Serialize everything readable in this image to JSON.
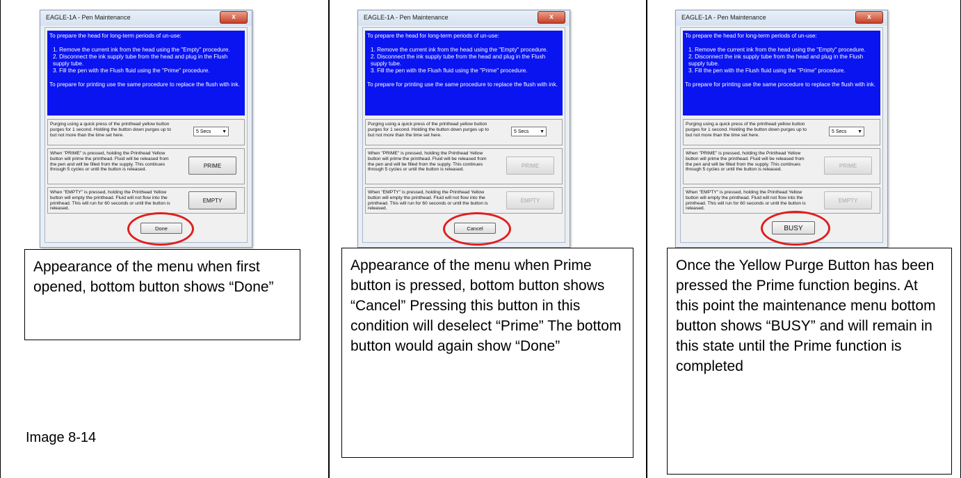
{
  "dialog": {
    "title": "EAGLE-1A - Pen Maintenance",
    "close_glyph": "x",
    "info_lines": [
      "To prepare the head for long-term periods of un-use:",
      "1. Remove the current ink from the head using the \"Empty\" procedure.",
      "2. Disconnect the ink supply tube from the head and plug in the Flush supply tube.",
      "3. Fill the pen with the Flush fluid using the \"Prime\" procedure.",
      "To prepare for printing use the same procedure to replace the flush with ink."
    ],
    "purge_text": "Purging using a quick press of the printhead yellow button purges for 1 second.  Holding the button down purges up to but not more than the time set here.",
    "purge_value": "5 Secs",
    "prime_text": "When \"PRIME\" is pressed, holding the Printhead Yellow button will prime the printhead. Fluid will be released from the pen and will be filled from the supply.  This continues through 5 cycles or until the button is released.",
    "prime_label": "PRIME",
    "empty_text": "When \"EMPTY\" is pressed, holding the Printhead Yellow button will empty the printhead. Fluid will not flow into the printhead. This will run for 60 seconds or until the button is released.",
    "empty_label": "EMPTY"
  },
  "panels": [
    {
      "bottom_label": "Done",
      "caption": "Appearance of the menu when first opened, bottom button shows “Done”"
    },
    {
      "bottom_label": "Cancel",
      "caption": "Appearance of the menu when Prime button is pressed, bottom button shows “Cancel” Pressing this button in this condition will deselect “Prime” The bottom button would again show “Done”"
    },
    {
      "bottom_label": "BUSY",
      "caption": "Once the Yellow Purge Button has been pressed the Prime function begins. At this point the maintenance menu bottom button shows “BUSY” and will remain in this state until the Prime function is completed"
    }
  ],
  "image_label": "Image 8-14",
  "annotation_color": "#e01e1e"
}
